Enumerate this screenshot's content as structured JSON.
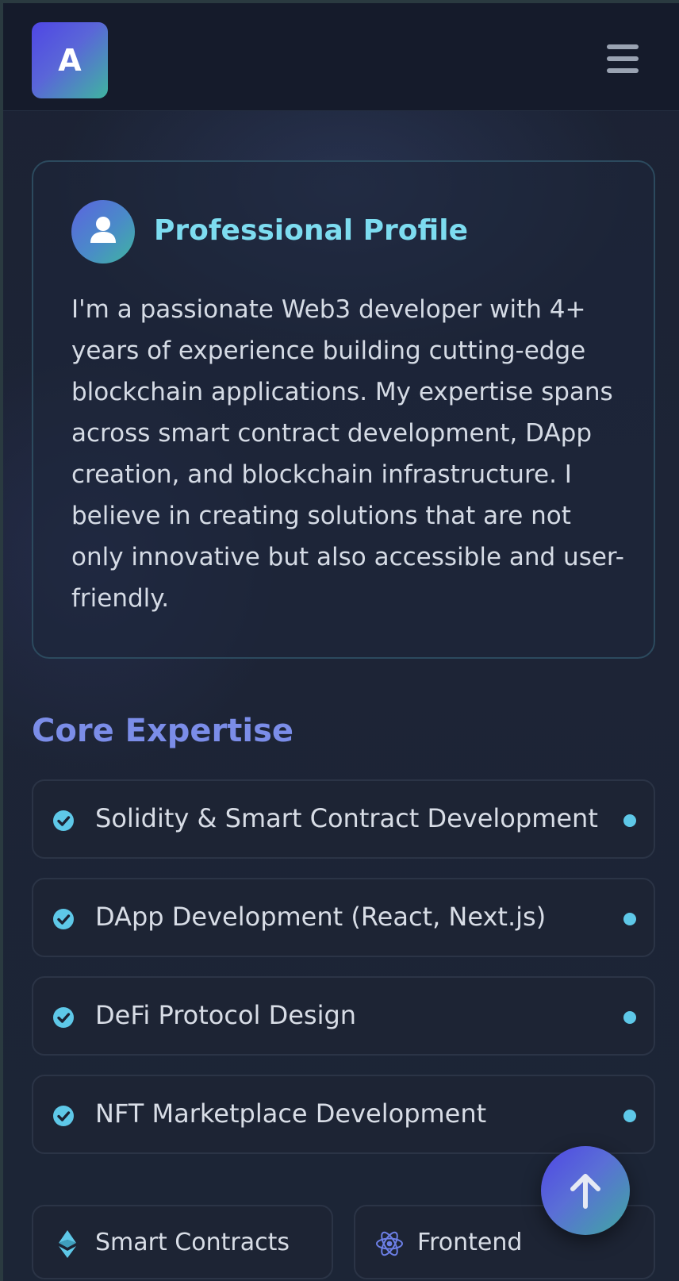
{
  "header": {
    "logo_letter": "A",
    "menu_icon": "hamburger-menu-icon"
  },
  "profile": {
    "icon": "user-icon",
    "title": "Professional Profile",
    "description": "I'm a passionate Web3 developer with 4+ years of experience building cutting-edge blockchain applications. My expertise spans across smart contract development, DApp creation, and blockchain infrastructure. I believe in creating solutions that are not only innovative but also accessible and user-friendly."
  },
  "expertise": {
    "title": "Core Expertise",
    "items": [
      {
        "label": "Solidity & Smart Contract Development"
      },
      {
        "label": "DApp Development (React, Next.js)"
      },
      {
        "label": "DeFi Protocol Design"
      },
      {
        "label": "NFT Marketplace Development"
      }
    ]
  },
  "tags": [
    {
      "label": "Smart Contracts",
      "icon": "ethereum-icon"
    },
    {
      "label": "Frontend",
      "icon": "react-atom-icon"
    }
  ],
  "scroll_top": {
    "icon": "arrow-up-icon"
  },
  "colors": {
    "accent_cyan": "#7ddcf0",
    "accent_indigo": "#7b8de8",
    "check_color": "#5ec8e8",
    "gradient_start": "#4f46e5",
    "gradient_end": "#3fb5a0"
  }
}
